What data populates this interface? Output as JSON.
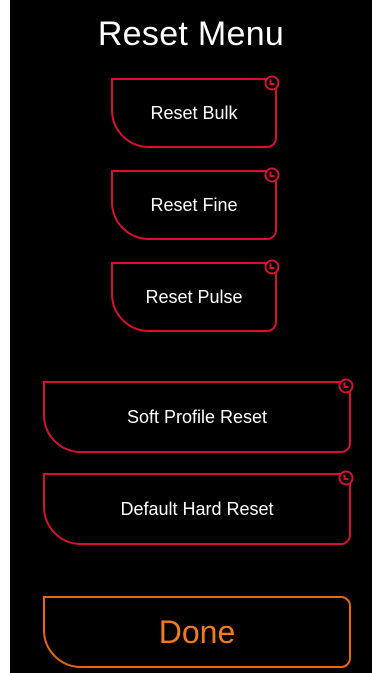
{
  "title": "Reset Menu",
  "buttons": {
    "reset_bulk": "Reset Bulk",
    "reset_fine": "Reset Fine",
    "reset_pulse": "Reset Pulse",
    "soft_profile_reset": "Soft Profile Reset",
    "default_hard_reset": "Default Hard Reset",
    "done": "Done"
  },
  "colors": {
    "background": "#000000",
    "button_border": "#d4122e",
    "done_accent": "#f07a1e",
    "text": "#ffffff"
  },
  "icons": {
    "button_corner": "clock-icon"
  }
}
